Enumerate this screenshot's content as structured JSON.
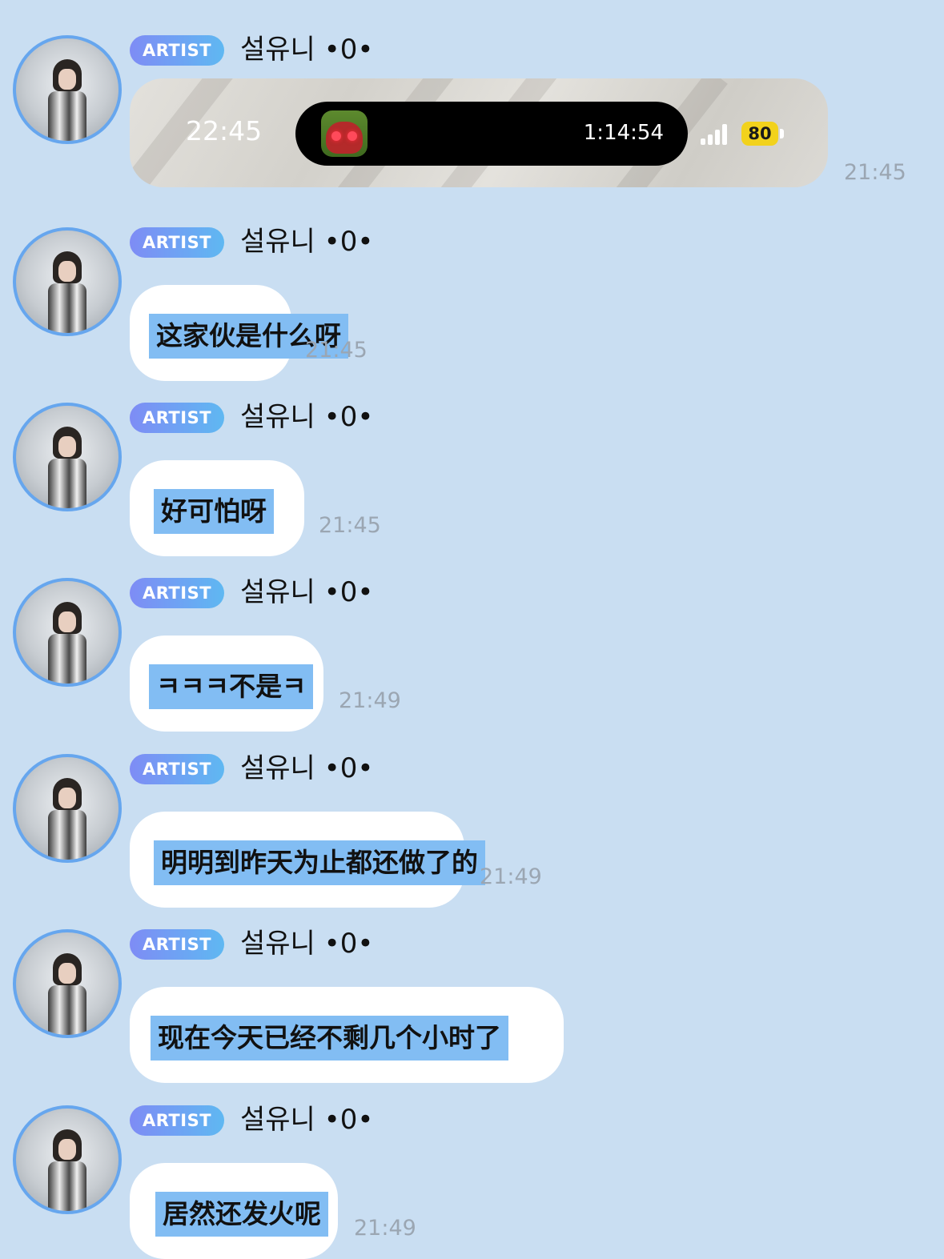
{
  "sender": {
    "badge": "ARTIST",
    "name": "설유니 •0•"
  },
  "messages": [
    {
      "type": "image",
      "time": "21:45",
      "screenshot": {
        "clock": "22:45",
        "timer": "1:14:54",
        "battery": "80",
        "app_icon": "owl-app-icon"
      }
    },
    {
      "type": "text",
      "text": "这家伙是什么呀",
      "time": "21:45"
    },
    {
      "type": "text",
      "text": "好可怕呀",
      "time": "21:45"
    },
    {
      "type": "text",
      "text": "ㅋㅋㅋ不是ㅋ",
      "time": "21:49"
    },
    {
      "type": "text",
      "text": "明明到昨天为止都还做了的",
      "time": "21:49"
    },
    {
      "type": "text",
      "text": "现在今天已经不剩几个小时了",
      "time": ""
    },
    {
      "type": "text",
      "text": "居然还发火呢",
      "time": "21:49"
    }
  ],
  "colors": {
    "background": "#c9def2",
    "bubble": "#ffffff",
    "highlight": "#82bdf3",
    "badge_start": "#7e8cf5",
    "badge_end": "#5fb8f2",
    "avatar_ring": "#66a6ee",
    "timestamp": "#9ba6b2"
  }
}
